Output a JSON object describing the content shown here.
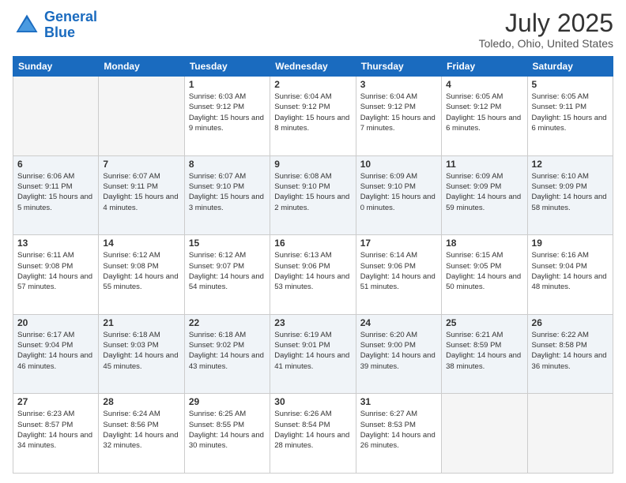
{
  "header": {
    "logo_line1": "General",
    "logo_line2": "Blue",
    "title": "July 2025",
    "subtitle": "Toledo, Ohio, United States"
  },
  "weekdays": [
    "Sunday",
    "Monday",
    "Tuesday",
    "Wednesday",
    "Thursday",
    "Friday",
    "Saturday"
  ],
  "weeks": [
    [
      {
        "day": "",
        "info": ""
      },
      {
        "day": "",
        "info": ""
      },
      {
        "day": "1",
        "info": "Sunrise: 6:03 AM\nSunset: 9:12 PM\nDaylight: 15 hours\nand 9 minutes."
      },
      {
        "day": "2",
        "info": "Sunrise: 6:04 AM\nSunset: 9:12 PM\nDaylight: 15 hours\nand 8 minutes."
      },
      {
        "day": "3",
        "info": "Sunrise: 6:04 AM\nSunset: 9:12 PM\nDaylight: 15 hours\nand 7 minutes."
      },
      {
        "day": "4",
        "info": "Sunrise: 6:05 AM\nSunset: 9:12 PM\nDaylight: 15 hours\nand 6 minutes."
      },
      {
        "day": "5",
        "info": "Sunrise: 6:05 AM\nSunset: 9:11 PM\nDaylight: 15 hours\nand 6 minutes."
      }
    ],
    [
      {
        "day": "6",
        "info": "Sunrise: 6:06 AM\nSunset: 9:11 PM\nDaylight: 15 hours\nand 5 minutes."
      },
      {
        "day": "7",
        "info": "Sunrise: 6:07 AM\nSunset: 9:11 PM\nDaylight: 15 hours\nand 4 minutes."
      },
      {
        "day": "8",
        "info": "Sunrise: 6:07 AM\nSunset: 9:10 PM\nDaylight: 15 hours\nand 3 minutes."
      },
      {
        "day": "9",
        "info": "Sunrise: 6:08 AM\nSunset: 9:10 PM\nDaylight: 15 hours\nand 2 minutes."
      },
      {
        "day": "10",
        "info": "Sunrise: 6:09 AM\nSunset: 9:10 PM\nDaylight: 15 hours\nand 0 minutes."
      },
      {
        "day": "11",
        "info": "Sunrise: 6:09 AM\nSunset: 9:09 PM\nDaylight: 14 hours\nand 59 minutes."
      },
      {
        "day": "12",
        "info": "Sunrise: 6:10 AM\nSunset: 9:09 PM\nDaylight: 14 hours\nand 58 minutes."
      }
    ],
    [
      {
        "day": "13",
        "info": "Sunrise: 6:11 AM\nSunset: 9:08 PM\nDaylight: 14 hours\nand 57 minutes."
      },
      {
        "day": "14",
        "info": "Sunrise: 6:12 AM\nSunset: 9:08 PM\nDaylight: 14 hours\nand 55 minutes."
      },
      {
        "day": "15",
        "info": "Sunrise: 6:12 AM\nSunset: 9:07 PM\nDaylight: 14 hours\nand 54 minutes."
      },
      {
        "day": "16",
        "info": "Sunrise: 6:13 AM\nSunset: 9:06 PM\nDaylight: 14 hours\nand 53 minutes."
      },
      {
        "day": "17",
        "info": "Sunrise: 6:14 AM\nSunset: 9:06 PM\nDaylight: 14 hours\nand 51 minutes."
      },
      {
        "day": "18",
        "info": "Sunrise: 6:15 AM\nSunset: 9:05 PM\nDaylight: 14 hours\nand 50 minutes."
      },
      {
        "day": "19",
        "info": "Sunrise: 6:16 AM\nSunset: 9:04 PM\nDaylight: 14 hours\nand 48 minutes."
      }
    ],
    [
      {
        "day": "20",
        "info": "Sunrise: 6:17 AM\nSunset: 9:04 PM\nDaylight: 14 hours\nand 46 minutes."
      },
      {
        "day": "21",
        "info": "Sunrise: 6:18 AM\nSunset: 9:03 PM\nDaylight: 14 hours\nand 45 minutes."
      },
      {
        "day": "22",
        "info": "Sunrise: 6:18 AM\nSunset: 9:02 PM\nDaylight: 14 hours\nand 43 minutes."
      },
      {
        "day": "23",
        "info": "Sunrise: 6:19 AM\nSunset: 9:01 PM\nDaylight: 14 hours\nand 41 minutes."
      },
      {
        "day": "24",
        "info": "Sunrise: 6:20 AM\nSunset: 9:00 PM\nDaylight: 14 hours\nand 39 minutes."
      },
      {
        "day": "25",
        "info": "Sunrise: 6:21 AM\nSunset: 8:59 PM\nDaylight: 14 hours\nand 38 minutes."
      },
      {
        "day": "26",
        "info": "Sunrise: 6:22 AM\nSunset: 8:58 PM\nDaylight: 14 hours\nand 36 minutes."
      }
    ],
    [
      {
        "day": "27",
        "info": "Sunrise: 6:23 AM\nSunset: 8:57 PM\nDaylight: 14 hours\nand 34 minutes."
      },
      {
        "day": "28",
        "info": "Sunrise: 6:24 AM\nSunset: 8:56 PM\nDaylight: 14 hours\nand 32 minutes."
      },
      {
        "day": "29",
        "info": "Sunrise: 6:25 AM\nSunset: 8:55 PM\nDaylight: 14 hours\nand 30 minutes."
      },
      {
        "day": "30",
        "info": "Sunrise: 6:26 AM\nSunset: 8:54 PM\nDaylight: 14 hours\nand 28 minutes."
      },
      {
        "day": "31",
        "info": "Sunrise: 6:27 AM\nSunset: 8:53 PM\nDaylight: 14 hours\nand 26 minutes."
      },
      {
        "day": "",
        "info": ""
      },
      {
        "day": "",
        "info": ""
      }
    ]
  ]
}
